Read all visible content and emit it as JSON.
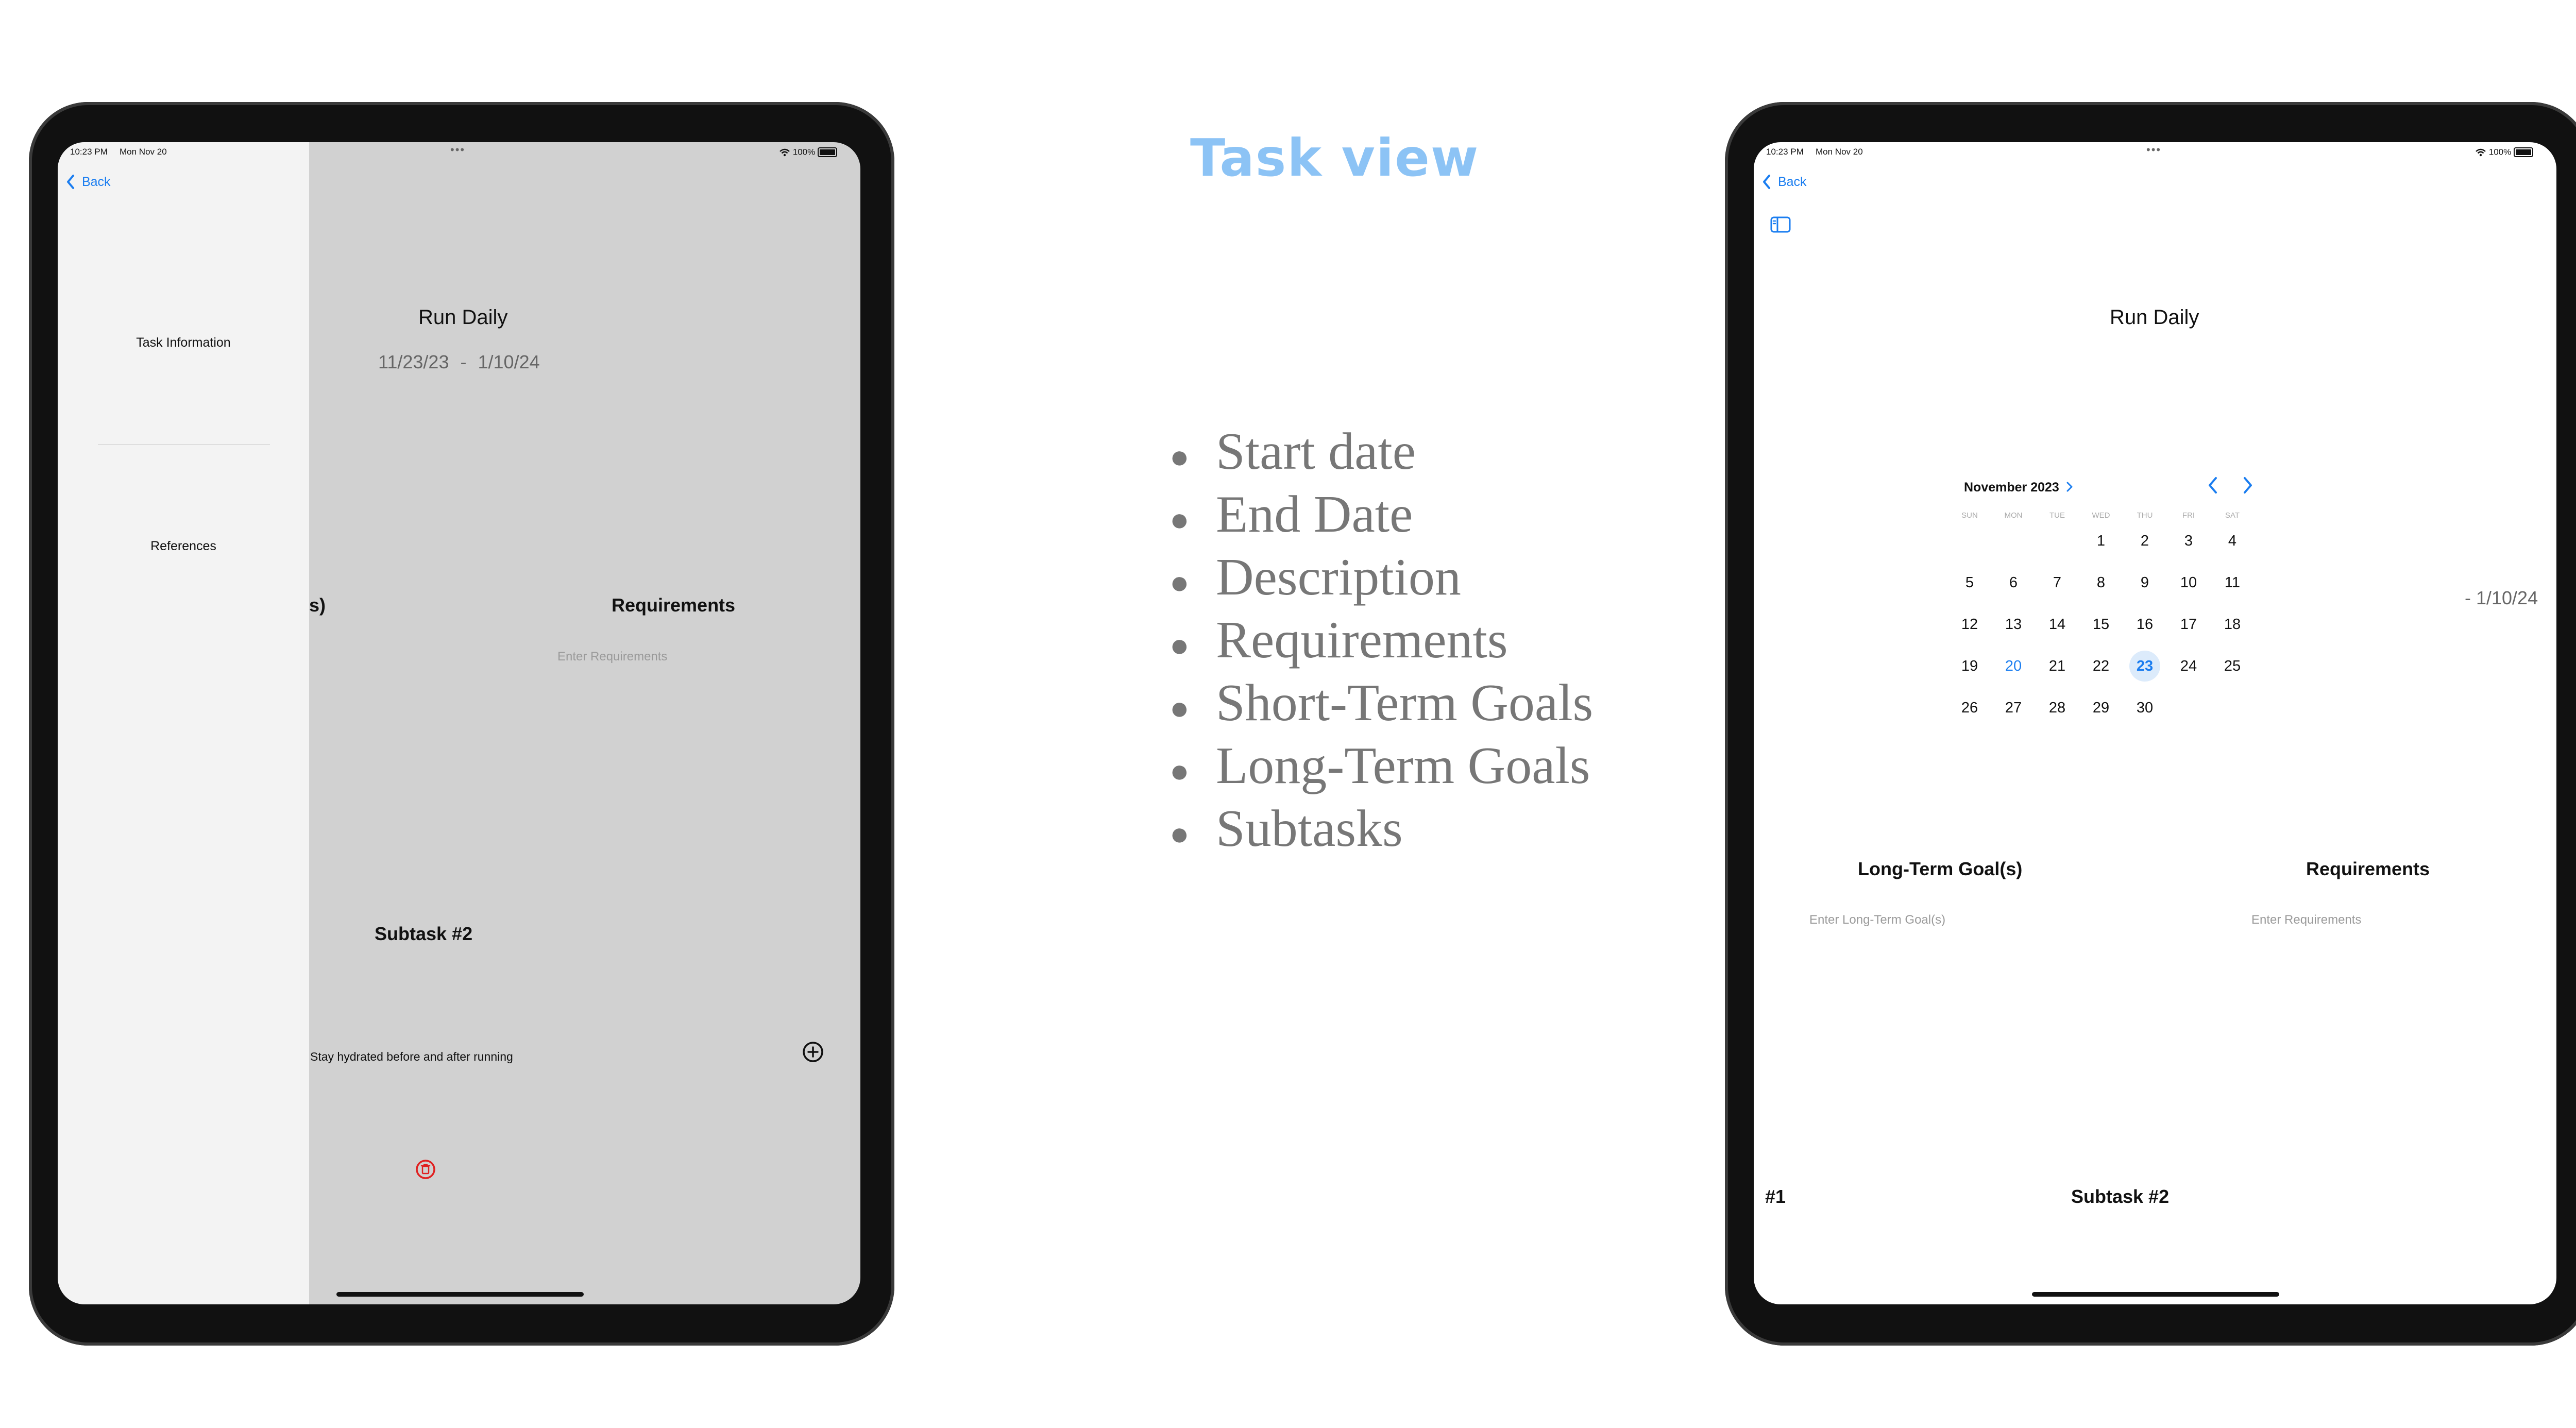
{
  "heading": "Task view",
  "bullets": [
    "Start date",
    "End Date",
    "Description",
    "Requirements",
    "Short-Term Goals",
    "Long-Term Goals",
    "Subtasks"
  ],
  "status_bar": {
    "time": "10:23 PM",
    "date": "Mon Nov 20",
    "dots": "•••",
    "battery": "100%"
  },
  "left_screen": {
    "back_label": "Back",
    "sidebar_items": [
      "Task Information",
      "References"
    ],
    "title": "Run Daily",
    "start_date": "11/23/23",
    "dash": "-",
    "end_date": "1/10/24",
    "cut_label": "s)",
    "requirements_heading": "Requirements",
    "requirements_placeholder": "Enter Requirements",
    "subtask_heading": "Subtask #2",
    "subtask_text": "Stay hydrated before and after running"
  },
  "right_screen": {
    "back_label": "Back",
    "title": "Run Daily",
    "end_date_partial": "- 1/10/24",
    "calendar": {
      "month_label": "November 2023",
      "weekdays": [
        "SUN",
        "MON",
        "TUE",
        "WED",
        "THU",
        "FRI",
        "SAT"
      ],
      "weeks": [
        [
          "",
          "",
          "",
          "1",
          "2",
          "3",
          "4"
        ],
        [
          "5",
          "6",
          "7",
          "8",
          "9",
          "10",
          "11"
        ],
        [
          "12",
          "13",
          "14",
          "15",
          "16",
          "17",
          "18"
        ],
        [
          "19",
          "20",
          "21",
          "22",
          "23",
          "24",
          "25"
        ],
        [
          "26",
          "27",
          "28",
          "29",
          "30",
          "",
          ""
        ]
      ],
      "today": "20",
      "selected": "23"
    },
    "long_term_heading": "Long-Term Goal(s)",
    "long_term_placeholder": "Enter Long-Term Goal(s)",
    "requirements_heading": "Requirements",
    "requirements_placeholder": "Enter Requirements",
    "subtask_cut_label": "#1",
    "subtask_heading": "Subtask #2"
  },
  "colors": {
    "accent": "#1a7df0",
    "heading": "#8cc3f5",
    "delete": "#e02020",
    "selected_bg": "#dcebfb"
  },
  "icons": [
    "chevron-left-icon",
    "sidebar-toggle-icon",
    "chevron-right-icon",
    "add-circle-icon",
    "trash-icon",
    "wifi-icon",
    "battery-icon"
  ]
}
